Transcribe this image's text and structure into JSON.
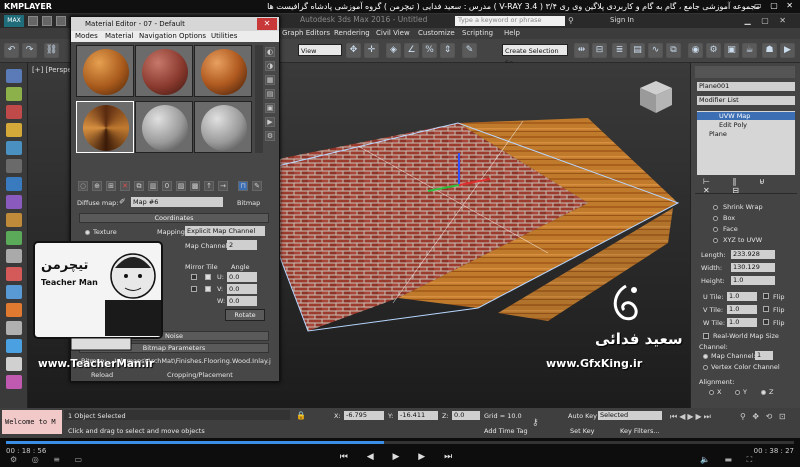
{
  "player": {
    "logo": "KMPLAYER",
    "title": "مجموعه آموزشی جامع ، گام به گام و کاربردی پلاگین وی ری ۳/۴ ( V-RAY 3.4 ) مدرس : سعید فدایی ( تیچرمن ) گروه آموزشی پادشاه گرافیست ها",
    "window_buttons": "▭ ▢ ✕",
    "time_current": "00 : 18 : 56",
    "time_total": "00 : 38 : 27",
    "progress": 0.48
  },
  "max": {
    "title": "Autodesk 3ds Max 2016 - Untitled",
    "search_placeholder": "Type a keyword or phrase",
    "signin": "Sign In",
    "menu": [
      "Graph Editors",
      "Rendering",
      "Civil View",
      "Customize",
      "Scripting",
      "Help"
    ],
    "toolbar": {
      "view_dropdown": "View",
      "selection_set": "Create Selection Se"
    },
    "viewport_label": "[+] [Perspective]",
    "logo_text": "MAX"
  },
  "material_editor": {
    "title": "Material Editor - 07 - Default",
    "close": "✕",
    "menu": [
      "Modes",
      "Material",
      "Navigation",
      "Options",
      "Utilities"
    ],
    "diffuse_label": "Diffuse map:",
    "map_name": "Map #6",
    "map_type": "Bitmap",
    "coordinates_rollout": "Coordinates",
    "texture_label": "Texture",
    "mapping_label": "Mapping:",
    "mapping_value": "Explicit Map Channel",
    "map_channel_label": "Map Channel:",
    "map_channel_value": "2",
    "mirror_label": "Mirror Tile",
    "angle_label": "Angle",
    "u_label": "U:",
    "v_label": "V:",
    "w_label": "W:",
    "angle_u": "0.0",
    "angle_v": "0.0",
    "angle_w": "0.0",
    "rotate_button": "Rotate",
    "noise_rollout": "Noise",
    "bitmap_params_rollout": "Bitmap Parameters",
    "bitmap_path": "Bitmap:  ...\\elemaps\\ArchMat\\Finishes.Flooring.Wood.Inlay.jpg",
    "reload_button": "Reload",
    "cropping_label": "Cropping/Placement"
  },
  "command_panel": {
    "object_name": "Plane001",
    "modifier_list": "Modifier List",
    "stack": [
      "UVW Map",
      "Edit Poly",
      "Plane"
    ],
    "mapping_options": [
      "Shrink Wrap",
      "Box",
      "Face",
      "XYZ to UVW"
    ],
    "length_label": "Length:",
    "length_value": "233.928",
    "width_label": "Width:",
    "width_value": "130.129",
    "height_label": "Height:",
    "height_value": "1.0",
    "utile_label": "U Tile:",
    "utile_value": "1.0",
    "vtile_label": "V Tile:",
    "vtile_value": "1.0",
    "wtile_label": "W Tile:",
    "wtile_value": "1.0",
    "flip_label": "Flip",
    "real_world": "Real-World Map Size",
    "channel_label": "Channel:",
    "map_channel": "Map Channel:",
    "map_channel_value": "1",
    "vertex_color": "Vertex Color Channel",
    "alignment_label": "Alignment:",
    "align_x": "X",
    "align_y": "Y",
    "align_z": "Z"
  },
  "status": {
    "maxscript": "Welcome to M",
    "selected": "1 Object Selected",
    "prompt": "Click and drag to select and move objects",
    "x_label": "X:",
    "x_value": "-6.795",
    "y_label": "Y:",
    "y_value": "-16.411",
    "z_label": "Z:",
    "z_value": "0.0",
    "grid": "Grid = 10.0",
    "add_time_tag": "Add Time Tag",
    "auto_key": "Auto Key",
    "selected_dd": "Selected",
    "set_key": "Set Key",
    "key_filters": "Key Filters..."
  },
  "watermark": {
    "teacher_name_fa": "تیچرمن",
    "teacher_name_en": "Teacher Man",
    "teacher_site": "www.TeacherMan.ir",
    "gfx_name_fa": "سعید فدائی",
    "gfx_site": "www.GfxKing.ir"
  }
}
